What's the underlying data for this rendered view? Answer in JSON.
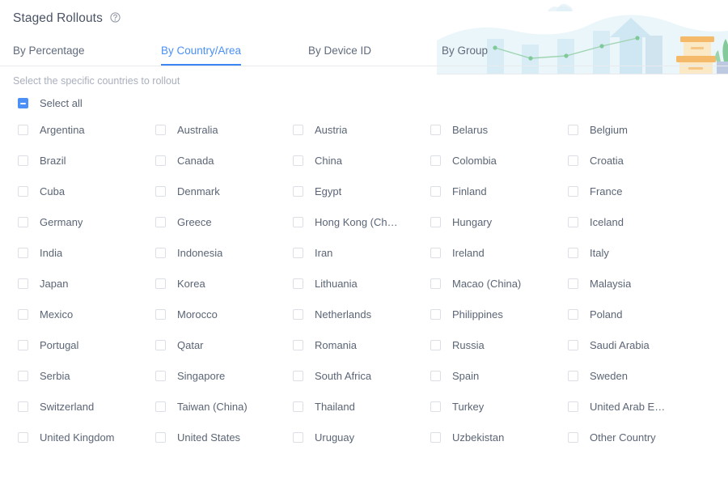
{
  "header": {
    "title": "Staged Rollouts",
    "help_icon": "question-circle-icon"
  },
  "tabs": [
    {
      "label": "By Percentage",
      "active": false
    },
    {
      "label": "By Country/Area",
      "active": true
    },
    {
      "label": "By Device ID",
      "active": false
    },
    {
      "label": "By Group",
      "active": false
    }
  ],
  "subtitle": "Select the specific countries to rollout",
  "select_all": {
    "label": "Select all",
    "state": "indeterminate"
  },
  "colors": {
    "accent": "#4a90f7",
    "tab_underline": "#3b88f5",
    "text": "#5b6575",
    "muted_text": "#a9b0bd",
    "checkbox_border": "#dcdfe6",
    "divider": "#e8eaee",
    "art_bar": "#d7ecf5",
    "art_hill": "#eaf6fa",
    "art_arrow": "#cfe7f2",
    "art_line": "#8fcfa8",
    "art_box_light": "#fbe2bb",
    "art_box_dark": "#f5b96a",
    "art_plant": "#84c99a",
    "art_pot": "#bcc9e0"
  },
  "countries": [
    "Argentina",
    "Australia",
    "Austria",
    "Belarus",
    "Belgium",
    "Brazil",
    "Canada",
    "China",
    "Colombia",
    "Croatia",
    "Cuba",
    "Denmark",
    "Egypt",
    "Finland",
    "France",
    "Germany",
    "Greece",
    "Hong Kong (Ch…",
    "Hungary",
    "Iceland",
    "India",
    "Indonesia",
    "Iran",
    "Ireland",
    "Italy",
    "Japan",
    "Korea",
    "Lithuania",
    "Macao (China)",
    "Malaysia",
    "Mexico",
    "Morocco",
    "Netherlands",
    "Philippines",
    "Poland",
    "Portugal",
    "Qatar",
    "Romania",
    "Russia",
    "Saudi Arabia",
    "Serbia",
    "Singapore",
    "South Africa",
    "Spain",
    "Sweden",
    "Switzerland",
    "Taiwan (China)",
    "Thailand",
    "Turkey",
    "United Arab E…",
    "United Kingdom",
    "United States",
    "Uruguay",
    "Uzbekistan",
    "Other Country"
  ]
}
